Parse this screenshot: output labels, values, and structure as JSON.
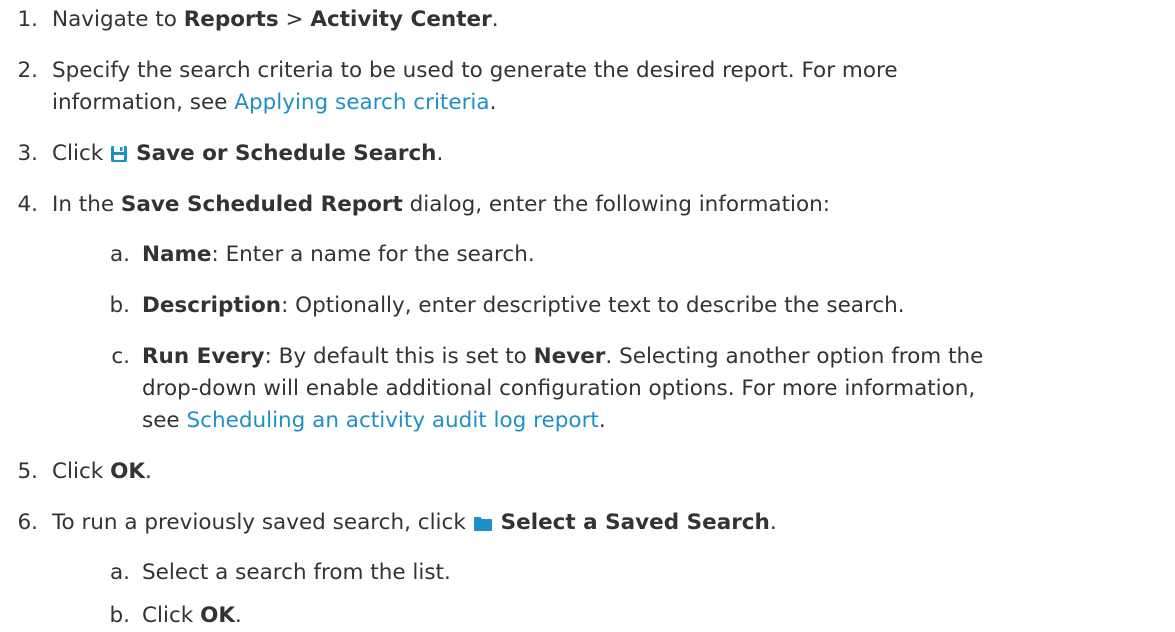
{
  "steps": [
    {
      "number": "1.",
      "pre": "Navigate to ",
      "bold1": "Reports",
      "mid": " > ",
      "bold2": "Activity Center",
      "post": "."
    },
    {
      "number": "2.",
      "line1": "Specify the search criteria to be used to generate the desired report. For more",
      "line2_pre": "information, see ",
      "link": "Applying search criteria",
      "line2_post": "."
    },
    {
      "number": "3.",
      "pre": "Click ",
      "icon": "save-icon",
      "bold": "Save or Schedule Search",
      "post": "."
    },
    {
      "number": "4.",
      "pre": "In the ",
      "bold": "Save Scheduled Report",
      "post": " dialog, enter the following information:",
      "substeps": [
        {
          "letter": "a.",
          "bold": "Name",
          "text": ": Enter a name for the search."
        },
        {
          "letter": "b.",
          "bold": "Description",
          "text": ": Optionally, enter descriptive text to describe the search."
        },
        {
          "letter": "c.",
          "bold": "Run Every",
          "text1": ": By default this is set to ",
          "bold2": "Never",
          "text2": ". Selecting another option from the",
          "line2": "drop-down will enable additional configuration options. For more information,",
          "line3_pre": "see ",
          "link": "Scheduling an activity audit log report",
          "line3_post": "."
        }
      ]
    },
    {
      "number": "5.",
      "pre": "Click ",
      "bold": "OK",
      "post": "."
    },
    {
      "number": "6.",
      "pre": "To run a previously saved search, click ",
      "icon": "folder-icon",
      "bold": "Select a Saved Search",
      "post": ".",
      "substeps": [
        {
          "letter": "a.",
          "text": "Select a search from the list."
        },
        {
          "letter": "b.",
          "pre": "Click ",
          "bold": "OK",
          "post": "."
        }
      ]
    }
  ],
  "colors": {
    "text": "#333333",
    "link": "#1e90c8",
    "icon": "#1e90c8"
  }
}
